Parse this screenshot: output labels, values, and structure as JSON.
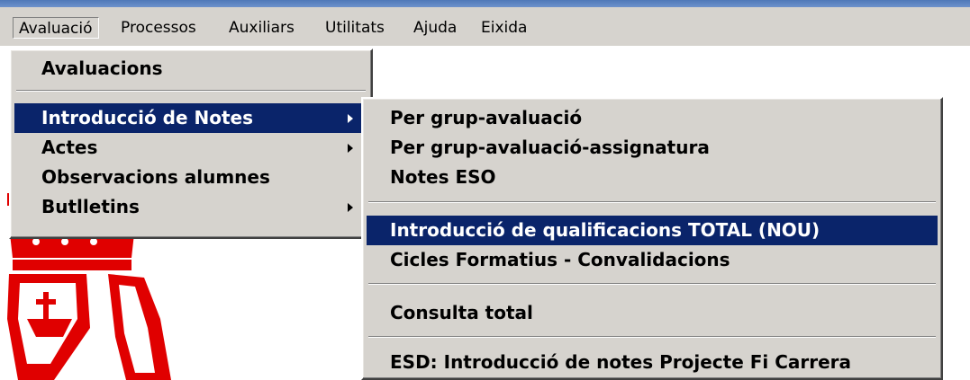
{
  "menubar": {
    "items": [
      {
        "label": "Avaluació"
      },
      {
        "label": "Processos"
      },
      {
        "label": "Auxiliars"
      },
      {
        "label": "Utilitats"
      },
      {
        "label": "Ajuda"
      },
      {
        "label": "Eixida"
      }
    ]
  },
  "avaluacio_menu": {
    "items": [
      {
        "label": "Avaluacions",
        "has_submenu": false
      },
      {
        "label": "Introducció de Notes",
        "has_submenu": true,
        "selected": true
      },
      {
        "label": "Actes",
        "has_submenu": true
      },
      {
        "label": "Observacions alumnes",
        "has_submenu": false
      },
      {
        "label": "Butlletins",
        "has_submenu": true
      }
    ]
  },
  "notes_submenu": {
    "items": [
      {
        "label": "Per grup-avaluació"
      },
      {
        "label": "Per grup-avaluació-assignatura"
      },
      {
        "label": "Notes ESO"
      },
      {
        "label": "Introducció de qualificacions TOTAL (NOU)",
        "selected": true
      },
      {
        "label": "Cicles Formatius - Convalidacions"
      },
      {
        "label": "Consulta total"
      },
      {
        "label": "ESD: Introducció de notes Projecte Fi Carrera"
      }
    ]
  },
  "colors": {
    "menu_bg": "#d6d3ce",
    "selection_bg": "#0a246a",
    "selection_fg": "#ffffff",
    "emblem": "#e00000"
  },
  "icons": {
    "submenu_arrow": "chevron-right-icon",
    "emblem": "crown-emblem"
  }
}
